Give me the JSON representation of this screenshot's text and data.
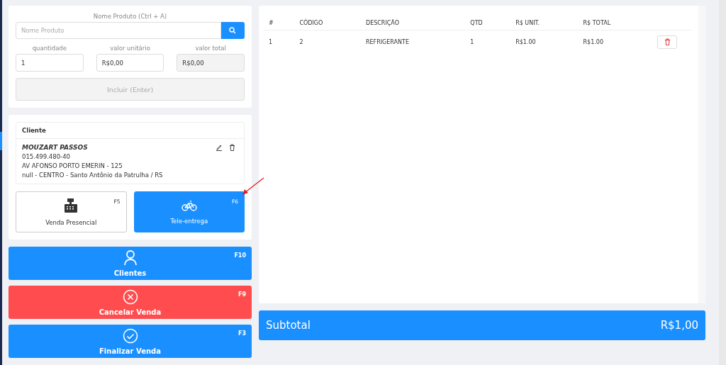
{
  "product": {
    "label": "Nome Produto (Ctrl + A)",
    "placeholder": "Nome Produto"
  },
  "fields": [
    {
      "label": "quantidade",
      "value": "1",
      "disabled": false
    },
    {
      "label": "valor unitário",
      "value": "R$0,00",
      "disabled": false
    },
    {
      "label": "valor total",
      "value": "R$0,00",
      "disabled": true
    }
  ],
  "include_button": {
    "label": "Incluir (Enter)",
    "disabled": true
  },
  "client": {
    "header": "Cliente",
    "name": "MOUZART PASSOS",
    "lines": [
      "015.499.480-40",
      "AV AFONSO PORTO EMERIN - 125",
      "null - CENTRO - Santo Antônio da Patrulha / RS"
    ]
  },
  "sale_modes": [
    {
      "kind": "register",
      "label": "Venda Presencial",
      "key": "F5",
      "selected": false
    },
    {
      "kind": "bike",
      "label": "Tele-entrega",
      "key": "F6",
      "selected": true
    }
  ],
  "actions": [
    {
      "kind": "user",
      "label": "Clientes",
      "key": "F10",
      "color": "#1a8fff"
    },
    {
      "kind": "cancel",
      "label": "Cancelar Venda",
      "key": "F9",
      "color": "#ff4d4f"
    },
    {
      "kind": "check",
      "label": "Finalizar Venda",
      "key": "F3",
      "color": "#1a8fff"
    }
  ],
  "table": {
    "columns": [
      "#",
      "CÓDIGO",
      "DESCRIÇÃO",
      "QTD",
      "R$ UNIT.",
      "R$ TOTAL"
    ],
    "rows": [
      [
        "1",
        "2",
        "REFRIGERANTE",
        "1",
        "R$1.00",
        "R$1.00"
      ]
    ]
  },
  "subtotal": {
    "label": "Subtotal",
    "value": "R$1,00"
  }
}
